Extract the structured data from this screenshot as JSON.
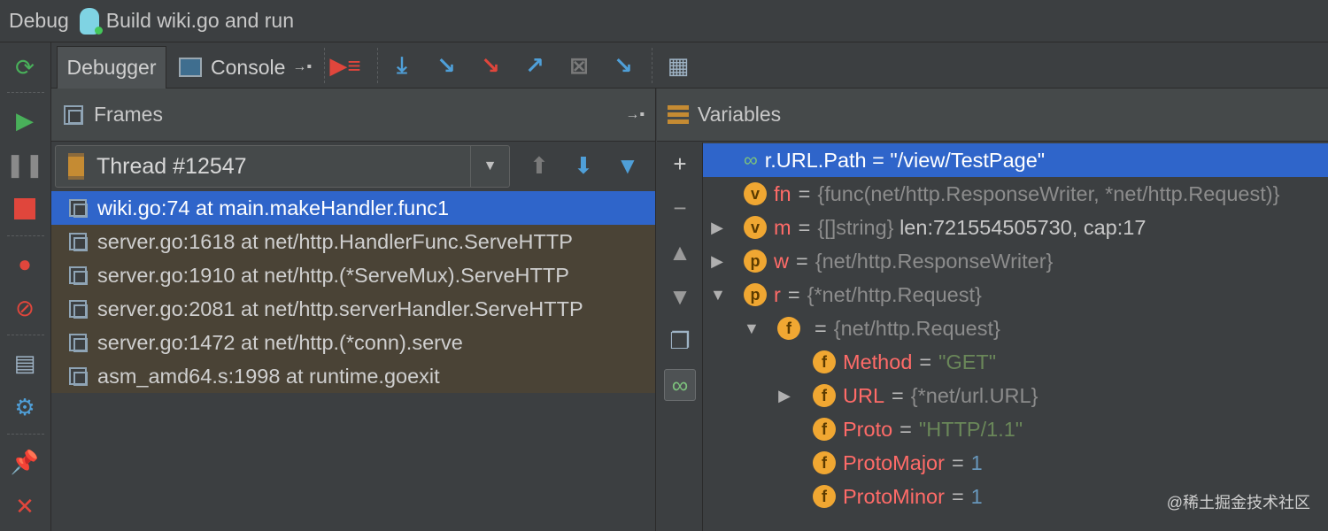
{
  "titlebar": {
    "label": "Debug",
    "config": "Build wiki.go and run"
  },
  "tabs": {
    "debugger": "Debugger",
    "console": "Console"
  },
  "frames": {
    "title": "Frames",
    "thread": "Thread #12547",
    "rows": [
      "wiki.go:74 at main.makeHandler.func1",
      "server.go:1618 at net/http.HandlerFunc.ServeHTTP",
      "server.go:1910 at net/http.(*ServeMux).ServeHTTP",
      "server.go:2081 at net/http.serverHandler.ServeHTTP",
      "server.go:1472 at net/http.(*conn).serve",
      "asm_amd64.s:1998 at runtime.goexit"
    ]
  },
  "variables": {
    "title": "Variables",
    "watch": "r.URL.Path = \"/view/TestPage\"",
    "rows": [
      {
        "badge": "v",
        "name": "fn",
        "type": "{func(net/http.ResponseWriter, *net/http.Request)}",
        "value": ""
      },
      {
        "badge": "v",
        "name": "m",
        "type": "{[]string}",
        "value": "len:721554505730, cap:17"
      },
      {
        "badge": "p",
        "name": "w",
        "type": "{net/http.ResponseWriter}",
        "value": ""
      },
      {
        "badge": "p",
        "name": "r",
        "type": "{*net/http.Request}",
        "value": ""
      },
      {
        "badge": "f",
        "name": "",
        "type": "{net/http.Request}",
        "value": ""
      },
      {
        "badge": "f",
        "name": "Method",
        "type": "",
        "value": "\"GET\""
      },
      {
        "badge": "f",
        "name": "URL",
        "type": "{*net/url.URL}",
        "value": ""
      },
      {
        "badge": "f",
        "name": "Proto",
        "type": "",
        "value": "\"HTTP/1.1\""
      },
      {
        "badge": "f",
        "name": "ProtoMajor",
        "type": "",
        "value": "1"
      },
      {
        "badge": "f",
        "name": "ProtoMinor",
        "type": "",
        "value": "1"
      }
    ]
  },
  "credit": "@稀土掘金技术社区",
  "icons": {
    "left_toolbar": [
      "rerun-icon",
      "resume-icon",
      "pause-icon",
      "stop-icon",
      "view-breakpoints-icon",
      "mute-breakpoints-icon",
      "restore-layout-icon",
      "settings-icon",
      "pin-icon",
      "close-icon"
    ],
    "toolbar": [
      "show-execution-point-icon",
      "step-over-icon",
      "step-into-icon",
      "force-step-into-icon",
      "step-out-icon",
      "drop-frame-icon",
      "run-to-cursor-icon",
      "evaluate-expression-icon"
    ]
  },
  "colors": {
    "selection": "#2f65ca",
    "badge": "#f0a732",
    "field_name": "#ff6b68",
    "string": "#6a8759",
    "number": "#6897bb"
  }
}
